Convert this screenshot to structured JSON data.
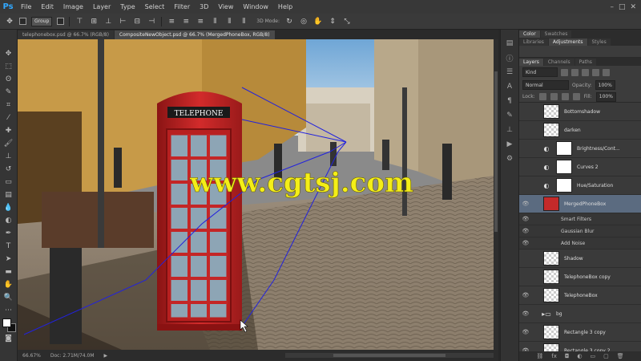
{
  "app": {
    "logo": "Ps",
    "menus": [
      "File",
      "Edit",
      "Image",
      "Layer",
      "Type",
      "Select",
      "Filter",
      "3D",
      "View",
      "Window",
      "Help"
    ]
  },
  "options": {
    "auto_select_label": "Group",
    "mode_label": "3D Mode:"
  },
  "tabs": [
    {
      "label": "telephonebox.psd @ 66.7% (RGB/8)",
      "active": false
    },
    {
      "label": "CompositeNewObject.psd @ 66.7% (MergedPhoneBox, RGB/8)",
      "active": true
    }
  ],
  "canvas": {
    "watermark": "www.cgtsj.com",
    "sign_text": "TELEPHONE"
  },
  "status": {
    "zoom": "66.67%",
    "doc": "Doc: 2.71M/74.0M"
  },
  "panels": {
    "top_tabs": [
      "Color",
      "Swatches"
    ],
    "mid_tabs": [
      "Libraries",
      "Adjustments",
      "Styles"
    ],
    "layer_tabs": [
      "Layers",
      "Channels",
      "Paths"
    ],
    "filter_kind": "Kind",
    "blend_mode": "Normal",
    "opacity_label": "Opacity:",
    "opacity_value": "100%",
    "lock_label": "Lock:",
    "fill_label": "Fill:",
    "fill_value": "100%"
  },
  "layers": [
    {
      "name": "Bottomshadow",
      "visible": false,
      "thumb": "checker",
      "selected": false,
      "sub": false
    },
    {
      "name": "darken",
      "visible": false,
      "thumb": "checker",
      "selected": false,
      "sub": false
    },
    {
      "name": "Brightness/Cont...",
      "visible": false,
      "thumb": "adj",
      "selected": false,
      "sub": false
    },
    {
      "name": "Curves 2",
      "visible": false,
      "thumb": "adj",
      "selected": false,
      "sub": false
    },
    {
      "name": "Hue/Saturation",
      "visible": false,
      "thumb": "adj",
      "selected": false,
      "sub": false
    },
    {
      "name": "MergedPhoneBox",
      "visible": true,
      "thumb": "red",
      "selected": true,
      "sub": false
    },
    {
      "name": "Smart Filters",
      "visible": true,
      "thumb": "white",
      "selected": false,
      "sub": true
    },
    {
      "name": "Gaussian Blur",
      "visible": true,
      "thumb": "",
      "selected": false,
      "sub": true
    },
    {
      "name": "Add Noise",
      "visible": true,
      "thumb": "",
      "selected": false,
      "sub": true
    },
    {
      "name": "Shadow",
      "visible": false,
      "thumb": "checker",
      "selected": false,
      "sub": false
    },
    {
      "name": "TelephoneBox copy",
      "visible": false,
      "thumb": "checker",
      "selected": false,
      "sub": false
    },
    {
      "name": "TelephoneBox",
      "visible": true,
      "thumb": "checker",
      "selected": false,
      "sub": false
    },
    {
      "name": "bg",
      "visible": true,
      "thumb": "folder",
      "selected": false,
      "sub": false
    },
    {
      "name": "Rectangle 3 copy",
      "visible": true,
      "thumb": "checker",
      "selected": false,
      "sub": false
    },
    {
      "name": "Rectangle 3 copy 2",
      "visible": true,
      "thumb": "checker",
      "selected": false,
      "sub": false
    }
  ]
}
